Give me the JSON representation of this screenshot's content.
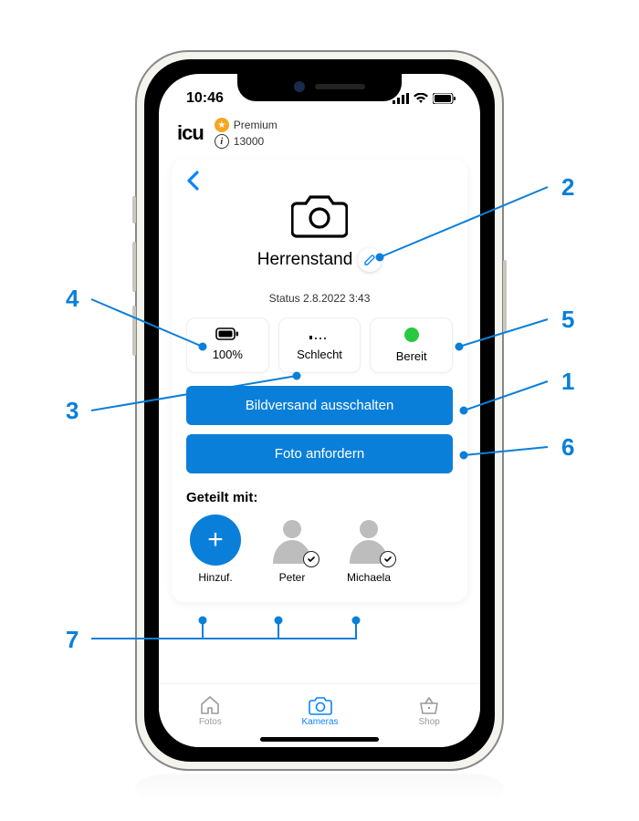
{
  "status_bar": {
    "time": "10:46"
  },
  "header": {
    "logo": "icu",
    "premium_label": "Premium",
    "points": "13000"
  },
  "card": {
    "title": "Herrenstand",
    "status_prefix": "Status",
    "status_date": "2.8.2022 3:43",
    "stats": {
      "battery": {
        "value": "100%"
      },
      "signal": {
        "value": "Schlecht"
      },
      "ready": {
        "value": "Bereit"
      }
    },
    "btn_disable_label": "Bildversand ausschalten",
    "btn_request_label": "Foto anfordern",
    "shared_title": "Geteilt mit:",
    "shared": {
      "add_label": "Hinzuf.",
      "user1": "Peter",
      "user2": "Michaela"
    }
  },
  "tabs": {
    "photos": "Fotos",
    "cameras": "Kameras",
    "shop": "Shop"
  },
  "callouts": {
    "1": "1",
    "2": "2",
    "3": "3",
    "4": "4",
    "5": "5",
    "6": "6",
    "7": "7"
  }
}
